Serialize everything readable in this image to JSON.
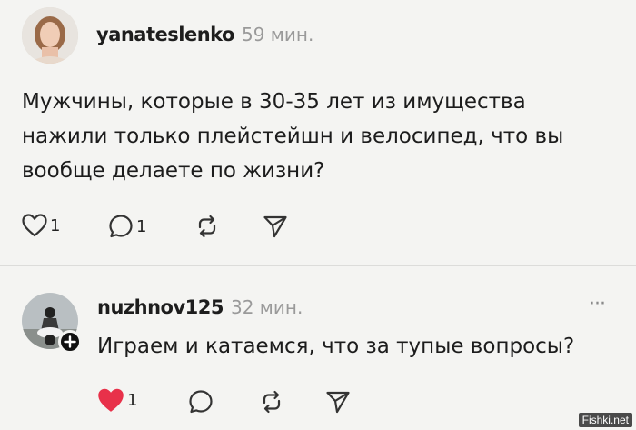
{
  "post": {
    "username": "yanateslenko",
    "time": "59 мин.",
    "text_lines": [
      "Мужчины, которые в 30-35 лет из имущества",
      "нажили только плейстейшн и велосипед, что вы",
      "вообще делаете по жизни?"
    ],
    "likes": "1",
    "replies": "1"
  },
  "reply": {
    "username": "nuzhnov125",
    "time": "32 мин.",
    "text": "Играем и катаемся, что за тупые вопросы?",
    "likes": "1",
    "more": "···"
  },
  "watermark": "Fishki.net",
  "colors": {
    "like_active": "#e8314a",
    "icon": "#333333",
    "time": "#9a9a9a"
  }
}
